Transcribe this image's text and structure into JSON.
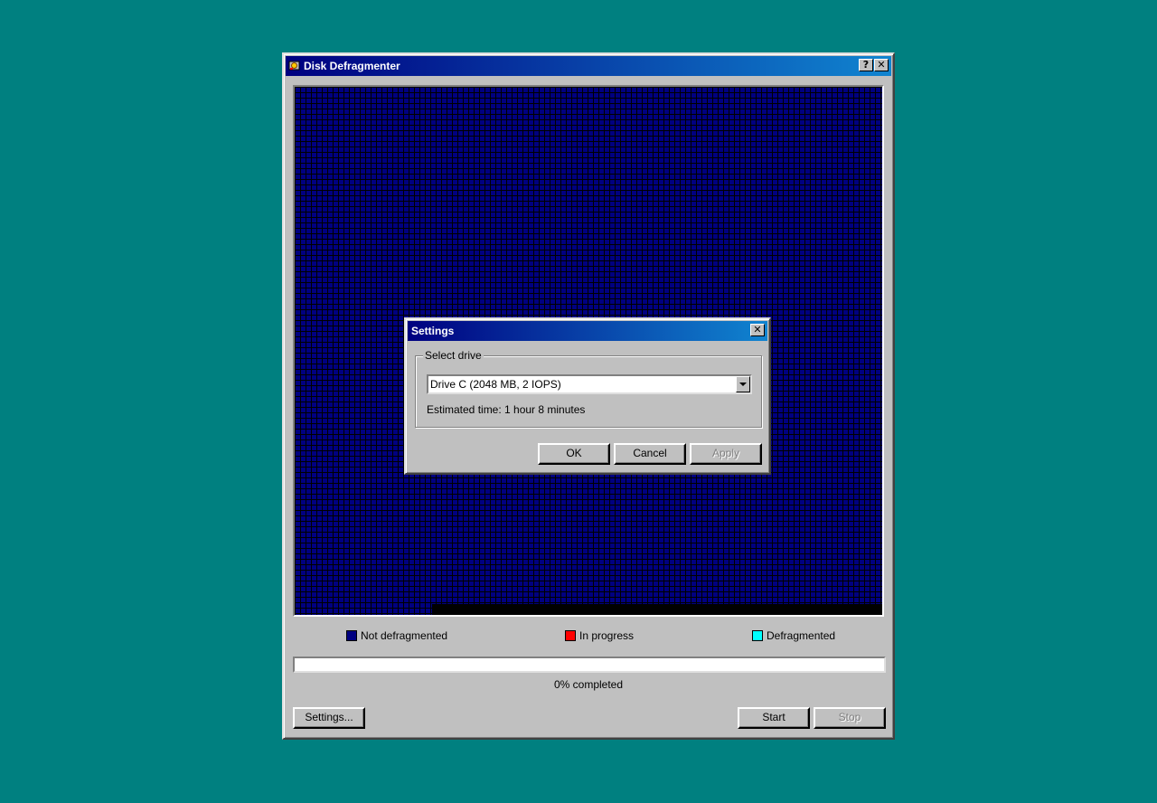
{
  "window": {
    "title": "Disk Defragmenter",
    "help_label": "?",
    "close_label": "✕"
  },
  "legend": [
    {
      "label": "Not defragmented",
      "color": "#000080"
    },
    {
      "label": "In progress",
      "color": "#ff0000"
    },
    {
      "label": "Defragmented",
      "color": "#00ffff"
    }
  ],
  "progress": {
    "value": 0,
    "label": "0% completed"
  },
  "buttons": {
    "settings": "Settings...",
    "start": "Start",
    "stop": "Stop"
  },
  "settings_dialog": {
    "title": "Settings",
    "close_label": "✕",
    "group_label": "Select drive",
    "drive_value": "Drive C (2048 MB, 2 IOPS)",
    "estimated_time": "Estimated time: 1 hour 8 minutes",
    "ok": "OK",
    "cancel": "Cancel",
    "apply": "Apply"
  }
}
